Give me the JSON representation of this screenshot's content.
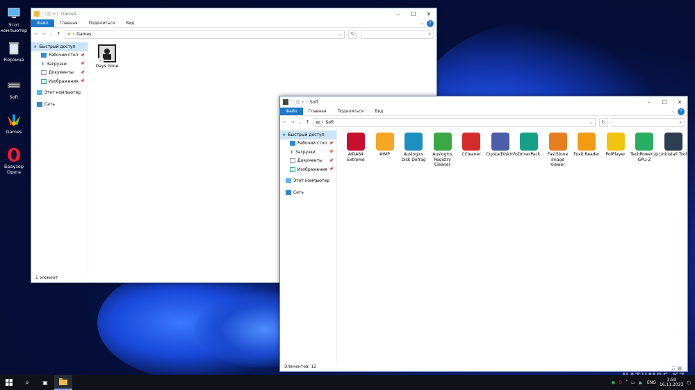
{
  "desktop": {
    "icons": [
      {
        "label": "Этот компьютер",
        "icon": "computer-icon"
      },
      {
        "label": "Корзина",
        "icon": "recycle-bin-icon"
      },
      {
        "label": "Soft",
        "icon": "folder-soft-icon"
      },
      {
        "label": "Games",
        "icon": "folder-games-icon"
      },
      {
        "label": "Браузер Opera",
        "icon": "opera-icon"
      }
    ]
  },
  "ribbon": {
    "file": "Файл",
    "home": "Главная",
    "share": "Поделиться",
    "view": "Вид",
    "help": "?"
  },
  "nav": {
    "quick_access": "Быстрый доступ",
    "desktop": "Рабочий стол",
    "downloads": "Загрузки",
    "documents": "Документы",
    "pictures": "Изображения",
    "this_pc": "Этот компьютер",
    "network": "Сеть"
  },
  "games_window": {
    "title": "Games",
    "path": "Games",
    "items": [
      {
        "label": "Days Gone",
        "icon": "days-gone-icon"
      }
    ],
    "status": "1 элемент"
  },
  "soft_window": {
    "title": "Soft",
    "path": "Soft",
    "status": "Элементов: 12",
    "items": [
      {
        "label": "AIDA64 Extreme",
        "icon": "aida64-icon",
        "color": "#c8102e"
      },
      {
        "label": "AIMP",
        "icon": "aimp-icon",
        "color": "#f5a623"
      },
      {
        "label": "Auslogics Disk Defrag",
        "icon": "disk-defrag-icon",
        "color": "#1c8fc0"
      },
      {
        "label": "Auslogics Registry Cleaner",
        "icon": "registry-cleaner-icon",
        "color": "#3aa845"
      },
      {
        "label": "CCleaner",
        "icon": "ccleaner-icon",
        "color": "#d62b2b"
      },
      {
        "label": "CrystalDiskInfo",
        "icon": "crystaldiskinfo-icon",
        "color": "#4a5fa8"
      },
      {
        "label": "DriverPack",
        "icon": "driverpack-icon",
        "color": "#16a085"
      },
      {
        "label": "FastStone Image Viewer",
        "icon": "faststone-icon",
        "color": "#e67e22"
      },
      {
        "label": "Foxit Reader",
        "icon": "foxit-icon",
        "color": "#f39c12"
      },
      {
        "label": "PotPlayer",
        "icon": "potplayer-icon",
        "color": "#f1c40f"
      },
      {
        "label": "TechPowerUp GPU-Z",
        "icon": "gpuz-icon",
        "color": "#27ae60"
      },
      {
        "label": "Uninstall Tool",
        "icon": "uninstall-tool-icon",
        "color": "#2c3e50"
      }
    ]
  },
  "taskbar": {
    "lang": "ENG",
    "time": "1:59",
    "date": "16.11.2023"
  },
  "watermark": "NATUMBE.KZ"
}
